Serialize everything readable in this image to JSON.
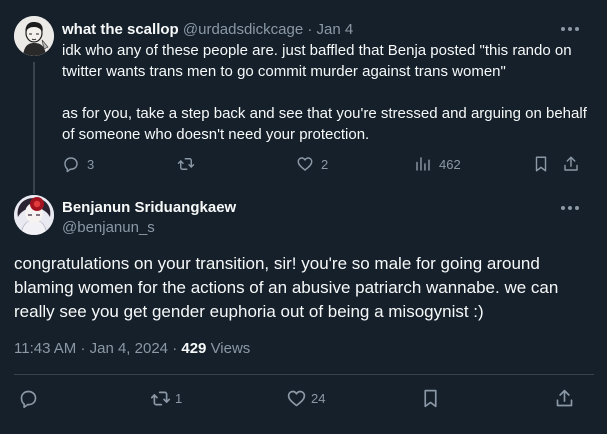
{
  "reply": {
    "display_name": "what the scallop",
    "handle": "@urdadsdickcage",
    "separator": "·",
    "date": "Jan 4",
    "paragraphs": [
      "idk who any of these people are. just baffled that Benja posted \"this rando on twitter wants trans men to go commit murder against trans women\"",
      "as for you, take a step back and see that you're stressed and arguing on behalf of someone who doesn't need your protection."
    ],
    "actions": {
      "replies": "3",
      "retweets": "",
      "likes": "2",
      "views": "462"
    },
    "icons": [
      "reply-icon",
      "retweet-icon",
      "like-icon",
      "views-icon",
      "bookmark-icon",
      "share-icon",
      "more-icon"
    ]
  },
  "tweet": {
    "display_name": "Benjanun Sriduangkaew",
    "handle": "@benjanun_s",
    "text": "congratulations on your transition, sir! you're so male for going around blaming women for the actions of an abusive patriarch wannabe. we can really see you get gender euphoria out of being a misogynist :)",
    "time": "11:43 AM",
    "date": "Jan 4, 2024",
    "separator": " · ",
    "views_count": "429",
    "views_label": "Views",
    "actions": {
      "replies": "",
      "retweets": "1",
      "likes": "24",
      "bookmarks": ""
    },
    "icons": [
      "reply-icon",
      "retweet-icon",
      "like-icon",
      "bookmark-icon",
      "share-icon",
      "more-icon"
    ]
  },
  "colors": {
    "background": "#15202b",
    "text_primary": "#f7f9f9",
    "text_secondary": "#8b98a5",
    "border": "#38444d"
  }
}
